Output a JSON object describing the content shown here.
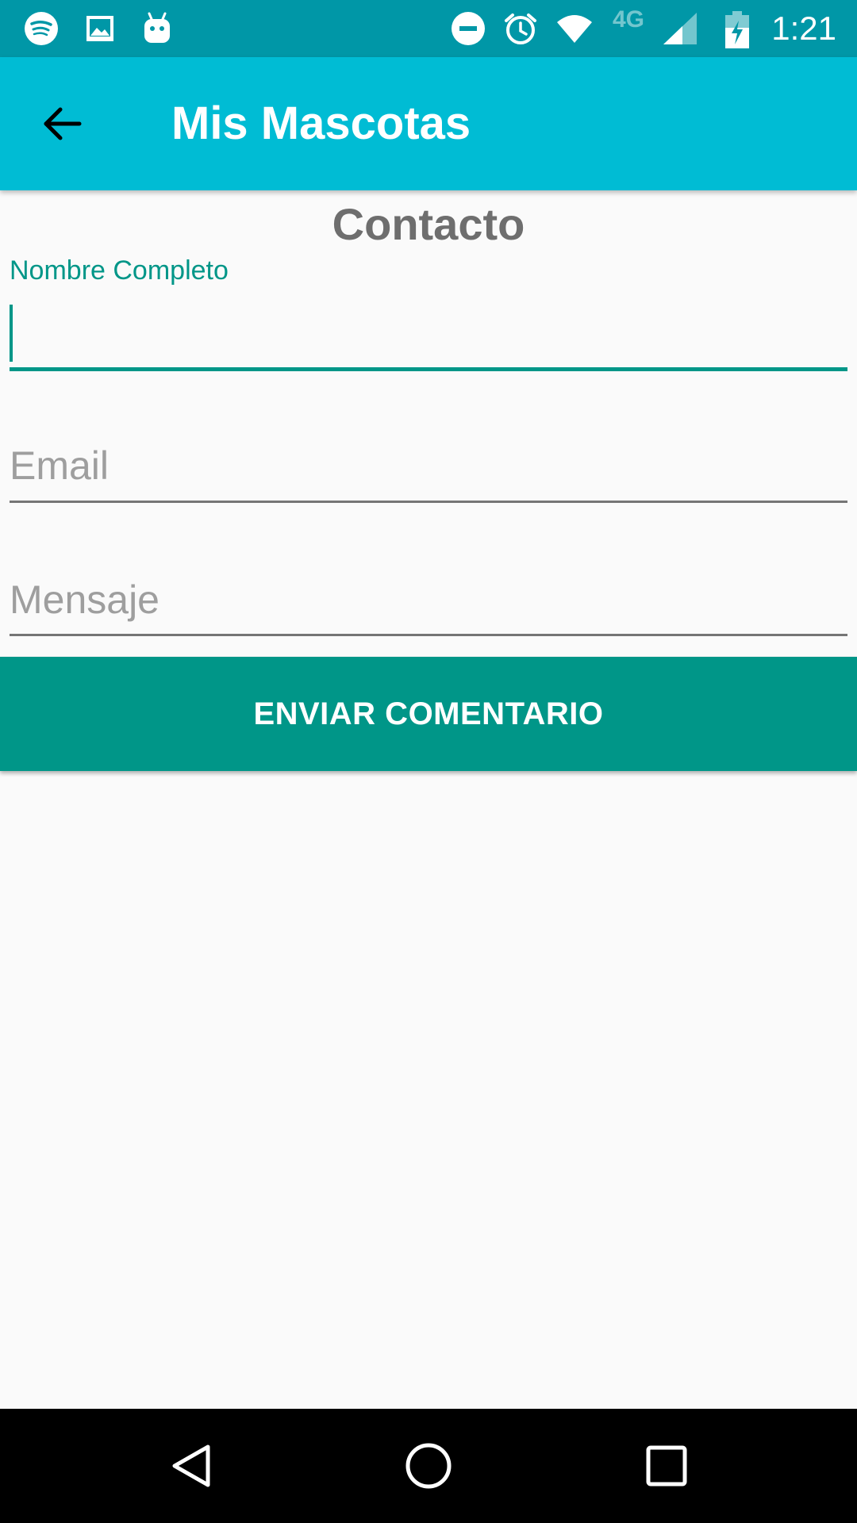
{
  "status_bar": {
    "time": "1:21",
    "network_label": "4G",
    "left_icons": [
      "spotify-icon",
      "image-icon",
      "android-debug-icon"
    ],
    "right_icons": [
      "do-not-disturb-icon",
      "alarm-icon",
      "wifi-icon",
      "signal-icon",
      "battery-charging-icon"
    ]
  },
  "app_bar": {
    "title": "Mis Mascotas",
    "back_icon": "arrow-back-icon"
  },
  "form": {
    "title": "Contacto",
    "fields": [
      {
        "label": "Nombre Completo",
        "value": "",
        "placeholder": "",
        "focused": true
      },
      {
        "label": "",
        "value": "",
        "placeholder": "Email",
        "focused": false
      },
      {
        "label": "",
        "value": "",
        "placeholder": "Mensaje",
        "focused": false
      }
    ],
    "submit_label": "ENVIAR COMENTARIO"
  },
  "nav_bar": {
    "buttons": [
      "back-triangle-icon",
      "home-circle-icon",
      "recents-square-icon"
    ]
  },
  "colors": {
    "status_bar": "#0097a7",
    "app_bar": "#00bcd4",
    "accent": "#009688",
    "background": "#fafafa",
    "title_text": "#6e6e6e",
    "hint_text": "#9e9e9e"
  }
}
